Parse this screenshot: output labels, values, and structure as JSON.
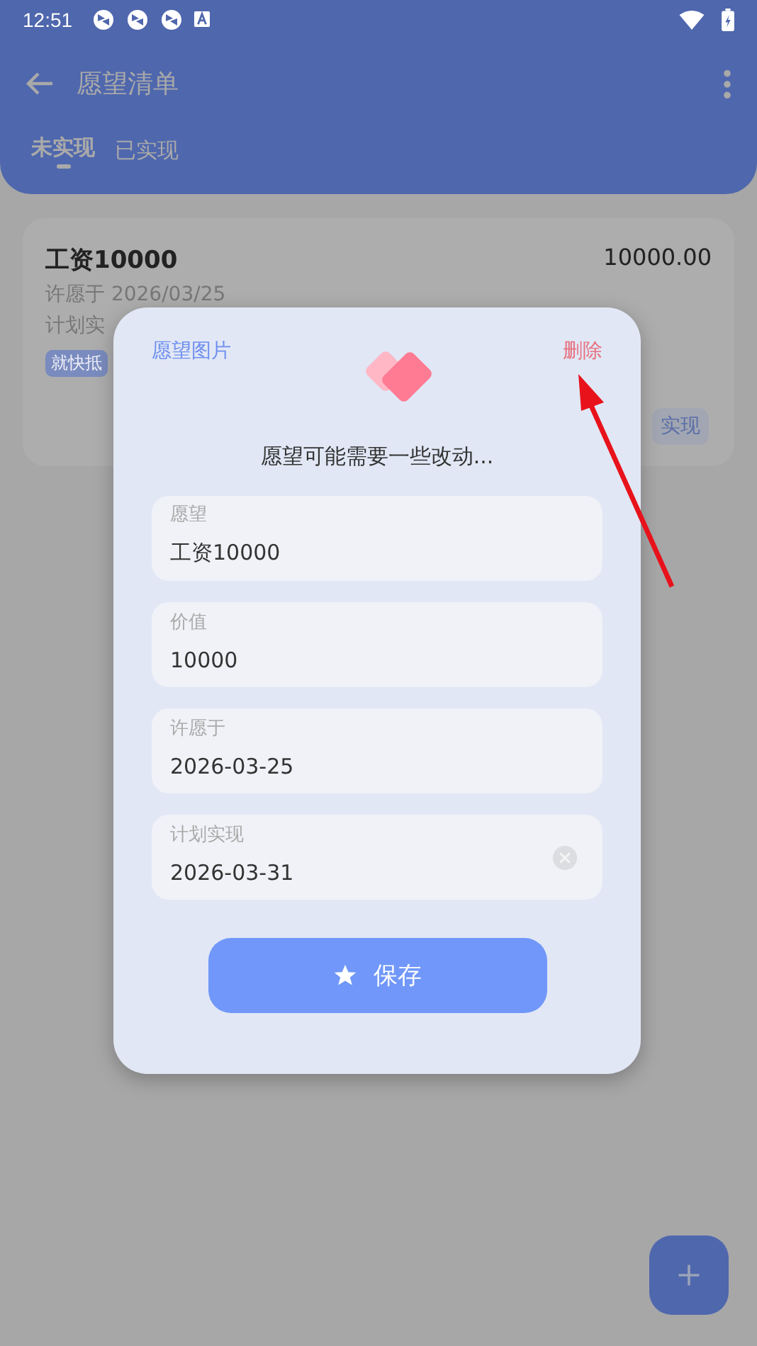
{
  "status_bar": {
    "time": "12:51"
  },
  "toolbar": {
    "title": "愿望清单"
  },
  "tabs": [
    {
      "label": "未实现",
      "selected": true
    },
    {
      "label": "已实现",
      "selected": false
    }
  ],
  "wish_card": {
    "name": "工资10000",
    "amount": "10000.00",
    "wished_on": "许愿于 2026/03/25",
    "planned": "计划实",
    "tag": "就快抵",
    "action": "实现"
  },
  "dialog": {
    "image_link": "愿望图片",
    "delete_link": "删除",
    "subtitle": "愿望可能需要一些改动...",
    "fields": [
      {
        "label": "愿望",
        "value": "工资10000",
        "clearable": false
      },
      {
        "label": "价值",
        "value": "10000",
        "clearable": false
      },
      {
        "label": "许愿于",
        "value": "2026-03-25",
        "clearable": false
      },
      {
        "label": "计划实现",
        "value": "2026-03-31",
        "clearable": true
      }
    ],
    "save_button": "保存"
  }
}
